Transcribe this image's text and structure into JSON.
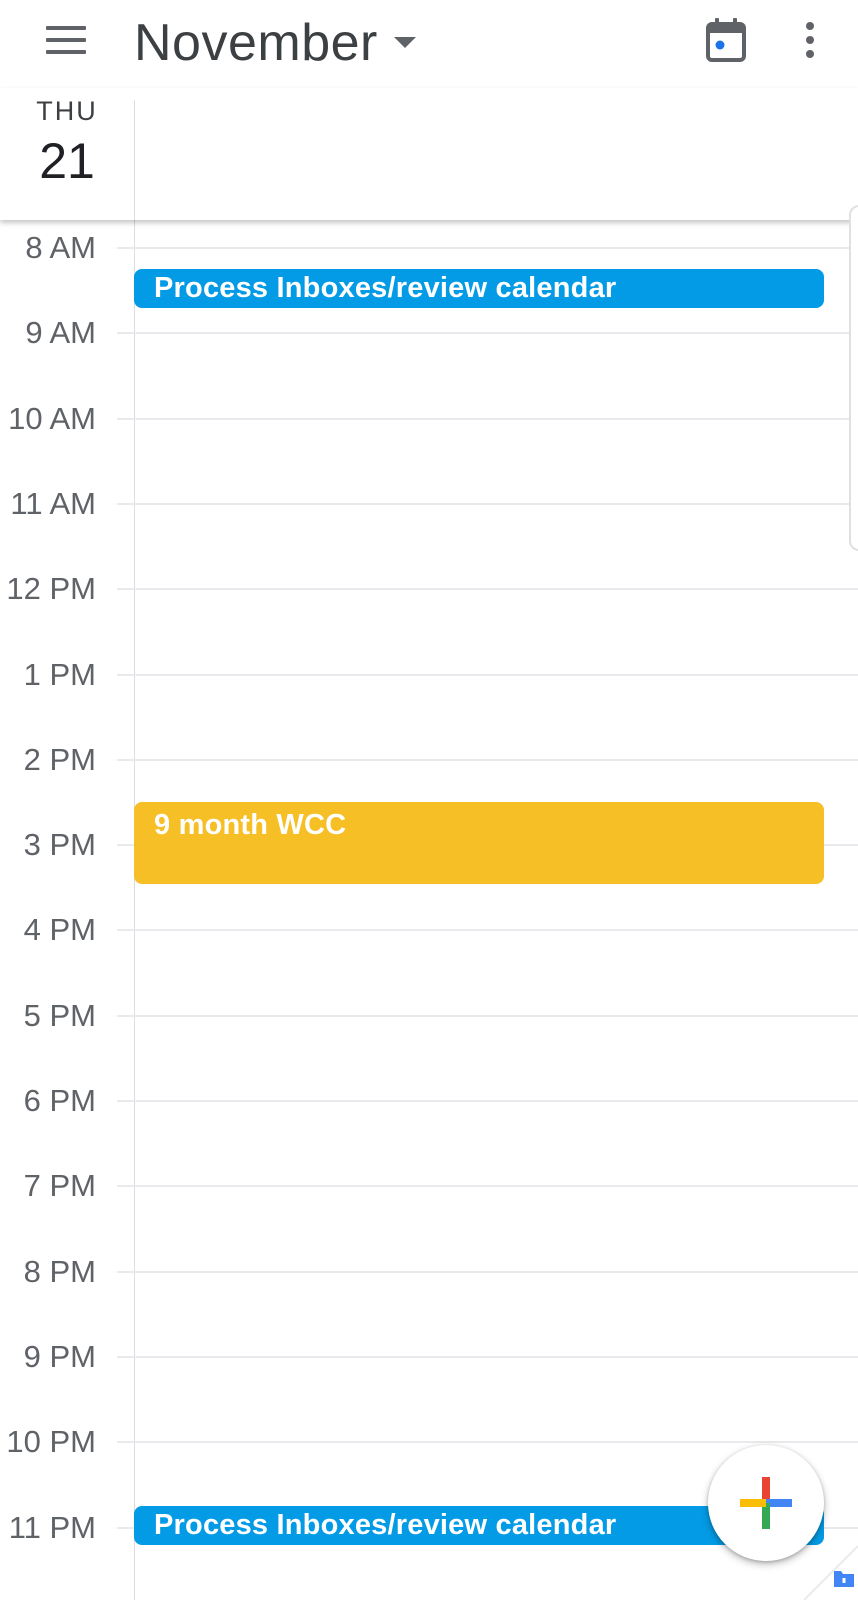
{
  "header": {
    "month": "November",
    "icons": {
      "menu": "hamburger-menu-icon",
      "dropdown": "caret-down-icon",
      "today": "calendar-today-icon",
      "more": "more-vertical-icon"
    }
  },
  "day": {
    "weekday": "THU",
    "date": "21"
  },
  "hours": [
    "8 AM",
    "9 AM",
    "10 AM",
    "11 AM",
    "12 PM",
    "1 PM",
    "2 PM",
    "3 PM",
    "4 PM",
    "5 PM",
    "6 PM",
    "7 PM",
    "8 PM",
    "9 PM",
    "10 PM",
    "11 PM"
  ],
  "events": [
    {
      "title": "Process Inboxes/review calendar",
      "color": "#039be5",
      "start_hour": 8.25,
      "end_hour": 8.75
    },
    {
      "title": "9 month WCC",
      "color": "#f6bf26",
      "start_hour": 14.5,
      "end_hour": 15.5
    },
    {
      "title": "Process Inboxes/review calendar",
      "color": "#039be5",
      "start_hour": 22.75,
      "end_hour": 23.25
    }
  ],
  "fab": {
    "icon": "plus-icon",
    "colors": [
      "#ea4335",
      "#4285f4",
      "#34a853",
      "#fbbc04"
    ]
  }
}
